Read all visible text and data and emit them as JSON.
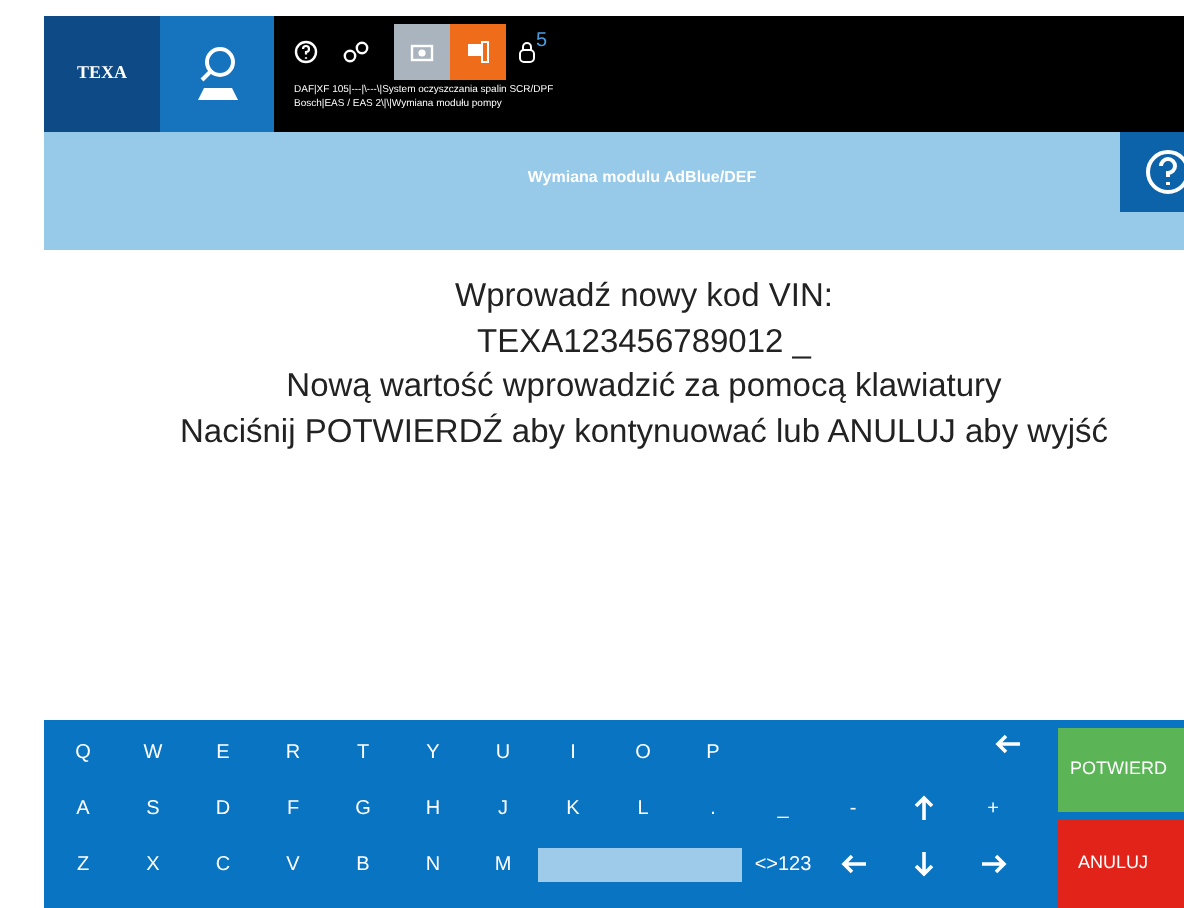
{
  "top_bar": {
    "logo": "TEXA",
    "lock_count": "5",
    "breadcrumb": [
      "DAF|XF 105|---|\\---\\|System oczyszczania spalin SCR/DPF",
      "Bosch|EAS / EAS 2\\|\\|Wymiana modułu pompy"
    ]
  },
  "header": {
    "title": "Wymiana modulu AdBlue/DEF"
  },
  "message": [
    "Wprowadź nowy kod VIN:",
    "TEXA123456789012 _",
    "Nową wartość wprowadzić za pomocą klawiatury",
    "Naciśnij POTWIERDŹ aby kontynuować lub ANULUJ aby wyjść"
  ],
  "keyboard": {
    "rows": [
      [
        {
          "kind": "key",
          "label": "Q"
        },
        {
          "kind": "key",
          "label": "W"
        },
        {
          "kind": "key",
          "label": "E"
        },
        {
          "kind": "key",
          "label": "R"
        },
        {
          "kind": "key",
          "label": "T"
        },
        {
          "kind": "key",
          "label": "Y"
        },
        {
          "kind": "key",
          "label": "U"
        },
        {
          "kind": "key",
          "label": "I"
        },
        {
          "kind": "key",
          "label": "O"
        },
        {
          "kind": "key",
          "label": "P"
        },
        {
          "kind": "gap"
        },
        {
          "kind": "gap"
        },
        {
          "kind": "gap"
        },
        {
          "kind": "backspace"
        }
      ],
      [
        {
          "kind": "key",
          "label": "A"
        },
        {
          "kind": "key",
          "label": "S"
        },
        {
          "kind": "key",
          "label": "D"
        },
        {
          "kind": "key",
          "label": "F"
        },
        {
          "kind": "key",
          "label": "G"
        },
        {
          "kind": "key",
          "label": "H"
        },
        {
          "kind": "key",
          "label": "J"
        },
        {
          "kind": "key",
          "label": "K"
        },
        {
          "kind": "key",
          "label": "L"
        },
        {
          "kind": "key",
          "label": "."
        },
        {
          "kind": "key",
          "label": "_"
        },
        {
          "kind": "key",
          "label": "-"
        },
        {
          "kind": "up"
        },
        {
          "kind": "key",
          "label": "+"
        }
      ],
      [
        {
          "kind": "key",
          "label": "Z"
        },
        {
          "kind": "key",
          "label": "X"
        },
        {
          "kind": "key",
          "label": "C"
        },
        {
          "kind": "key",
          "label": "V"
        },
        {
          "kind": "key",
          "label": "B"
        },
        {
          "kind": "key",
          "label": "N"
        },
        {
          "kind": "key",
          "label": "M"
        },
        {
          "kind": "space"
        },
        {
          "kind": "covered"
        },
        {
          "kind": "covered"
        },
        {
          "kind": "key",
          "label": "<>123"
        },
        {
          "kind": "left"
        },
        {
          "kind": "down"
        },
        {
          "kind": "right"
        }
      ]
    ]
  },
  "buttons": {
    "confirm": "POTWIERD",
    "cancel": "ANULUJ"
  }
}
